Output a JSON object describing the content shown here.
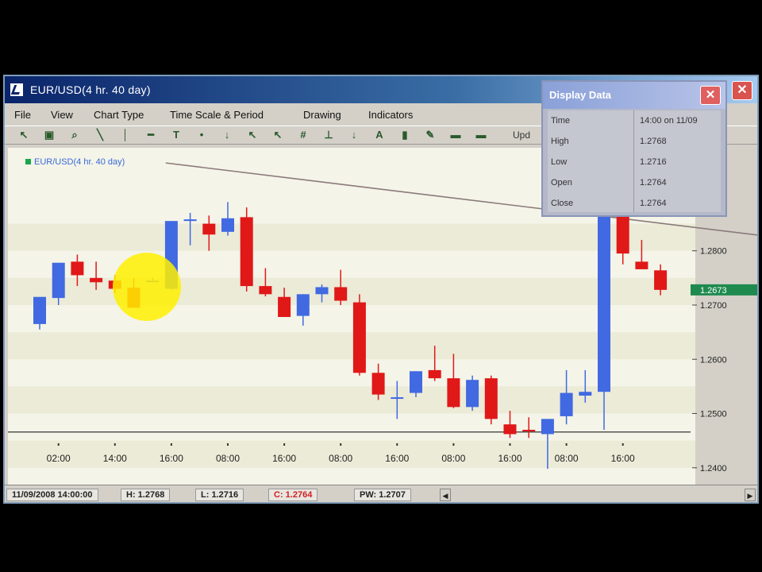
{
  "window": {
    "title": "EUR/USD(4 hr.  40 day)"
  },
  "menu": [
    {
      "label": "File"
    },
    {
      "label": "View"
    },
    {
      "label": "Chart Type"
    },
    {
      "label": "Time Scale & Period"
    },
    {
      "label": "Drawing"
    },
    {
      "label": "Indicators"
    }
  ],
  "toolbar": {
    "icons": [
      "pointer-icon",
      "print-icon",
      "zoom-icon",
      "trendline-icon",
      "vertical-line-icon",
      "horizontal-line-icon",
      "text-icon",
      "point-icon",
      "arrow-down-icon",
      "arrow-icon",
      "arrow-alt-icon",
      "grid-icon",
      "baseline-icon",
      "marker-icon",
      "letter-a-icon",
      "bar-icon",
      "pencil-icon",
      "dash-icon",
      "dash-alt-icon"
    ],
    "update_label": "Upd"
  },
  "chart": {
    "legend": "EUR/USD(4 hr.  40 day)",
    "current_price_tag": "1.2673",
    "colors": {
      "up": "#4169e1",
      "down": "#e01818",
      "tag": "#1e8a4e"
    }
  },
  "chart_data": {
    "type": "candlestick",
    "y_axis_labels": [
      "1.2800",
      "1.2700",
      "1.2600",
      "1.2500",
      "1.2400"
    ],
    "y_tick_values": [
      1.28,
      1.27,
      1.26,
      1.25,
      1.24
    ],
    "ylim": [
      1.2366,
      1.299
    ],
    "x_tick_labels": [
      "02:00",
      "14:00",
      "16:00",
      "08:00",
      "16:00",
      "08:00",
      "16:00",
      "08:00",
      "16:00",
      "08:00",
      "16:00"
    ],
    "x_tick_candles": [
      1,
      4,
      7,
      10,
      13,
      16,
      19,
      22,
      25,
      28,
      31
    ],
    "trendline": [
      [
        6.7,
        1.2962
      ],
      [
        40.3,
        1.282
      ]
    ],
    "candles": [
      {
        "o": 1.2665,
        "h": 1.269,
        "l": 1.2655,
        "c": 1.2715
      },
      {
        "o": 1.2713,
        "h": 1.2735,
        "l": 1.27,
        "c": 1.2778
      },
      {
        "o": 1.278,
        "h": 1.2793,
        "l": 1.2735,
        "c": 1.2755
      },
      {
        "o": 1.275,
        "h": 1.278,
        "l": 1.2728,
        "c": 1.2742
      },
      {
        "o": 1.2745,
        "h": 1.2755,
        "l": 1.2722,
        "c": 1.273
      },
      {
        "o": 1.2732,
        "h": 1.275,
        "l": 1.27,
        "c": 1.2695
      },
      {
        "o": 1.2745,
        "h": 1.275,
        "l": 1.2745,
        "c": 1.2745
      },
      {
        "o": 1.273,
        "h": 1.2735,
        "l": 1.2728,
        "c": 1.2855
      },
      {
        "o": 1.2855,
        "h": 1.287,
        "l": 1.281,
        "c": 1.2858
      },
      {
        "o": 1.285,
        "h": 1.2865,
        "l": 1.28,
        "c": 1.283
      },
      {
        "o": 1.2835,
        "h": 1.289,
        "l": 1.2828,
        "c": 1.286
      },
      {
        "o": 1.2862,
        "h": 1.288,
        "l": 1.2725,
        "c": 1.2735
      },
      {
        "o": 1.2735,
        "h": 1.2768,
        "l": 1.2716,
        "c": 1.272
      },
      {
        "o": 1.2715,
        "h": 1.2732,
        "l": 1.2678,
        "c": 1.2678
      },
      {
        "o": 1.268,
        "h": 1.272,
        "l": 1.2662,
        "c": 1.272
      },
      {
        "o": 1.272,
        "h": 1.2738,
        "l": 1.2705,
        "c": 1.2733
      },
      {
        "o": 1.2733,
        "h": 1.2765,
        "l": 1.27,
        "c": 1.2708
      },
      {
        "o": 1.2705,
        "h": 1.272,
        "l": 1.257,
        "c": 1.2575
      },
      {
        "o": 1.2575,
        "h": 1.2592,
        "l": 1.2525,
        "c": 1.2535
      },
      {
        "o": 1.2528,
        "h": 1.256,
        "l": 1.249,
        "c": 1.253
      },
      {
        "o": 1.2538,
        "h": 1.2578,
        "l": 1.253,
        "c": 1.2578
      },
      {
        "o": 1.258,
        "h": 1.2625,
        "l": 1.256,
        "c": 1.2565
      },
      {
        "o": 1.2565,
        "h": 1.261,
        "l": 1.251,
        "c": 1.2512
      },
      {
        "o": 1.2512,
        "h": 1.257,
        "l": 1.2505,
        "c": 1.2562
      },
      {
        "o": 1.2565,
        "h": 1.257,
        "l": 1.248,
        "c": 1.249
      },
      {
        "o": 1.248,
        "h": 1.2505,
        "l": 1.2455,
        "c": 1.2462
      },
      {
        "o": 1.247,
        "h": 1.2493,
        "l": 1.2455,
        "c": 1.2468
      },
      {
        "o": 1.2462,
        "h": 1.2482,
        "l": 1.2398,
        "c": 1.249
      },
      {
        "o": 1.2495,
        "h": 1.258,
        "l": 1.248,
        "c": 1.2538
      },
      {
        "o": 1.2533,
        "h": 1.258,
        "l": 1.252,
        "c": 1.254
      },
      {
        "o": 1.254,
        "h": 1.292,
        "l": 1.247,
        "c": 1.2905
      },
      {
        "o": 1.2905,
        "h": 1.2935,
        "l": 1.2775,
        "c": 1.2795
      },
      {
        "o": 1.278,
        "h": 1.282,
        "l": 1.277,
        "c": 1.2766
      },
      {
        "o": 1.2764,
        "h": 1.2775,
        "l": 1.2718,
        "c": 1.2728
      }
    ]
  },
  "display_data": {
    "title": "Display Data",
    "rows": [
      {
        "label": "Time",
        "value": "14:00 on 11/09"
      },
      {
        "label": "High",
        "value": "1.2768"
      },
      {
        "label": "Low",
        "value": "1.2716"
      },
      {
        "label": "Open",
        "value": "1.2764"
      },
      {
        "label": "Close",
        "value": "1.2764"
      }
    ]
  },
  "status": {
    "datetime": "11/09/2008 14:00:00",
    "high": "H: 1.2768",
    "low": "L: 1.2716",
    "close": "C: 1.2764",
    "pw": "PW: 1.2707"
  }
}
